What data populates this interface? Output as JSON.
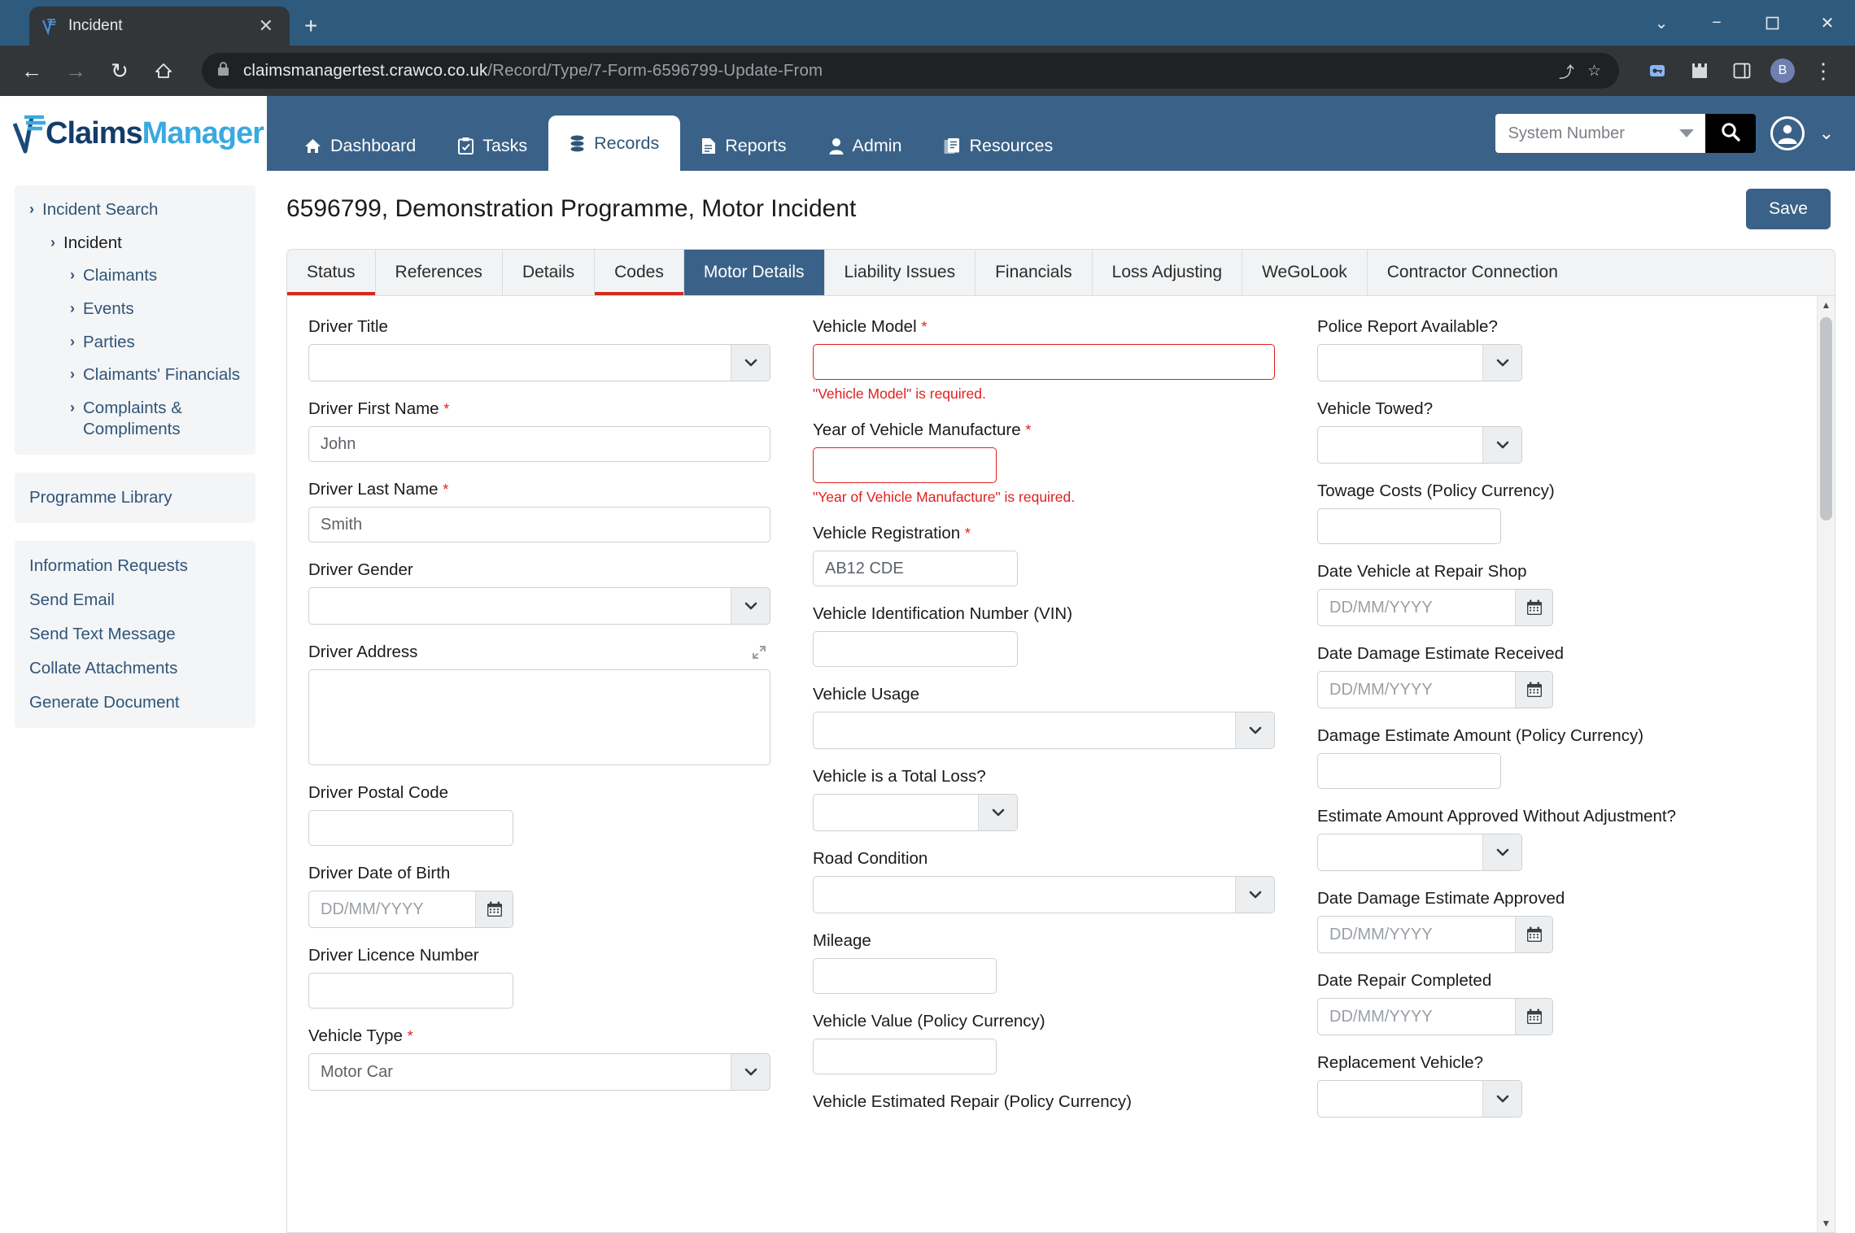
{
  "browser": {
    "tab_title": "Incident",
    "favicon": "claimsmanager-icon",
    "close_label": "✕",
    "newtab_label": "+",
    "window_minimize": "−",
    "window_restore": "❐",
    "window_close": "✕",
    "window_chevron": "⌄",
    "back": "←",
    "forward": "→",
    "reload": "↻",
    "home": "⌂",
    "lock_icon": "🔒",
    "url_domain": "claimsmanagertest.crawco.co.uk",
    "url_path": "/Record/Type/7-Form-6596799-Update-From",
    "share_icon": "⤴",
    "bookmark_icon": "☆",
    "profile_initial": "B",
    "menu_icon": "⋮"
  },
  "header": {
    "logo_part1": "Claims",
    "logo_part2": "Manager",
    "nav": [
      {
        "label": "Dashboard",
        "icon": "home-icon",
        "glyph": "🏠",
        "active": false
      },
      {
        "label": "Tasks",
        "icon": "clipboard-icon",
        "glyph": "🗒",
        "active": false
      },
      {
        "label": "Records",
        "icon": "database-icon",
        "glyph": "🗄",
        "active": true
      },
      {
        "label": "Reports",
        "icon": "document-icon",
        "glyph": "📄",
        "active": false
      },
      {
        "label": "Admin",
        "icon": "person-icon",
        "glyph": "👤",
        "active": false
      },
      {
        "label": "Resources",
        "icon": "books-icon",
        "glyph": "📑",
        "active": false
      }
    ],
    "search_placeholder": "System Number",
    "search_value": "",
    "search_button_icon": "search-icon",
    "user_icon": "user-avatar-icon",
    "user_chevron": "⌄"
  },
  "sidebar": {
    "tree": [
      {
        "label": "Incident Search",
        "level": 0,
        "chevron": "›",
        "current": false
      },
      {
        "label": "Incident",
        "level": 1,
        "chevron": "›",
        "current": true
      },
      {
        "label": "Claimants",
        "level": 2,
        "chevron": "›",
        "current": false
      },
      {
        "label": "Events",
        "level": 2,
        "chevron": "›",
        "current": false
      },
      {
        "label": "Parties",
        "level": 2,
        "chevron": "›",
        "current": false
      },
      {
        "label": "Claimants' Financials",
        "level": 2,
        "chevron": "›",
        "current": false
      },
      {
        "label": "Complaints & Compliments",
        "level": 2,
        "chevron": "›",
        "current": false
      }
    ],
    "library": [
      "Programme Library"
    ],
    "actions": [
      "Information Requests",
      "Send Email",
      "Send Text Message",
      "Collate Attachments",
      "Generate Document"
    ]
  },
  "main": {
    "page_title": "6596799, Demonstration Programme, Motor Incident",
    "save_label": "Save",
    "tabs": [
      {
        "label": "Status",
        "active": false,
        "error": true
      },
      {
        "label": "References",
        "active": false,
        "error": false
      },
      {
        "label": "Details",
        "active": false,
        "error": false
      },
      {
        "label": "Codes",
        "active": false,
        "error": true
      },
      {
        "label": "Motor Details",
        "active": true,
        "error": false
      },
      {
        "label": "Liability Issues",
        "active": false,
        "error": false
      },
      {
        "label": "Financials",
        "active": false,
        "error": false
      },
      {
        "label": "Loss Adjusting",
        "active": false,
        "error": false
      },
      {
        "label": "WeGoLook",
        "active": false,
        "error": false
      },
      {
        "label": "Contractor Connection",
        "active": false,
        "error": false
      }
    ]
  },
  "form": {
    "date_placeholder": "DD/MM/YYYY",
    "column_a": [
      {
        "label": "Driver Title",
        "type": "select",
        "value": "",
        "required": false,
        "width": "full"
      },
      {
        "label": "Driver First Name",
        "type": "text",
        "value": "John",
        "required": true,
        "width": "full"
      },
      {
        "label": "Driver Last Name",
        "type": "text",
        "value": "Smith",
        "required": true,
        "width": "full"
      },
      {
        "label": "Driver Gender",
        "type": "select",
        "value": "",
        "required": false,
        "width": "full"
      },
      {
        "label": "Driver Address",
        "type": "textarea",
        "value": "",
        "required": false,
        "width": "full",
        "expandable": true
      },
      {
        "label": "Driver Postal Code",
        "type": "text",
        "value": "",
        "required": false,
        "width": "md"
      },
      {
        "label": "Driver Date of Birth",
        "type": "date",
        "value": "",
        "required": false,
        "width": "md"
      },
      {
        "label": "Driver Licence Number",
        "type": "text",
        "value": "",
        "required": false,
        "width": "md"
      },
      {
        "label": "Vehicle Type",
        "type": "select",
        "value": "Motor Car",
        "required": true,
        "width": "full"
      }
    ],
    "column_b": [
      {
        "label": "Vehicle Model",
        "type": "text",
        "value": "",
        "required": true,
        "width": "full",
        "error": "\"Vehicle Model\" is required."
      },
      {
        "label": "Year of Vehicle Manufacture",
        "type": "text",
        "value": "",
        "required": true,
        "width": "sm",
        "error": "\"Year of Vehicle Manufacture\" is required."
      },
      {
        "label": "Vehicle Registration",
        "type": "text",
        "value": "AB12 CDE",
        "required": true,
        "width": "md"
      },
      {
        "label": "Vehicle Identification Number (VIN)",
        "type": "text",
        "value": "",
        "required": false,
        "width": "md"
      },
      {
        "label": "Vehicle Usage",
        "type": "select",
        "value": "",
        "required": false,
        "width": "full"
      },
      {
        "label": "Vehicle is a Total Loss?",
        "type": "select",
        "value": "",
        "required": false,
        "width": "md"
      },
      {
        "label": "Road Condition",
        "type": "select",
        "value": "",
        "required": false,
        "width": "full"
      },
      {
        "label": "Mileage",
        "type": "text",
        "value": "",
        "required": false,
        "width": "sm"
      },
      {
        "label": "Vehicle Value (Policy Currency)",
        "type": "text",
        "value": "",
        "required": false,
        "width": "sm"
      },
      {
        "label": "Vehicle Estimated Repair (Policy Currency)",
        "type": "label-only",
        "value": "",
        "required": false,
        "width": "sm"
      }
    ],
    "column_c": [
      {
        "label": "Police Report Available?",
        "type": "select",
        "value": "",
        "required": false,
        "width": "md"
      },
      {
        "label": "Vehicle Towed?",
        "type": "select",
        "value": "",
        "required": false,
        "width": "md"
      },
      {
        "label": "Towage Costs (Policy Currency)",
        "type": "text",
        "value": "",
        "required": false,
        "width": "sm"
      },
      {
        "label": "Date Vehicle at Repair Shop",
        "type": "date",
        "value": "",
        "required": false,
        "width": "wide"
      },
      {
        "label": "Date Damage Estimate Received",
        "type": "date",
        "value": "",
        "required": false,
        "width": "wide"
      },
      {
        "label": "Damage Estimate Amount (Policy Currency)",
        "type": "text",
        "value": "",
        "required": false,
        "width": "sm"
      },
      {
        "label": "Estimate Amount Approved Without Adjustment?",
        "type": "select",
        "value": "",
        "required": false,
        "width": "md"
      },
      {
        "label": "Date Damage Estimate Approved",
        "type": "date",
        "value": "",
        "required": false,
        "width": "wide"
      },
      {
        "label": "Date Repair Completed",
        "type": "date",
        "value": "",
        "required": false,
        "width": "wide"
      },
      {
        "label": "Replacement Vehicle?",
        "type": "select",
        "value": "",
        "required": false,
        "width": "md"
      }
    ],
    "scrollbar": {
      "up": "▲",
      "down": "▼"
    }
  },
  "colors": {
    "brand_blue": "#3a6288",
    "brand_cyan": "#3aa9e0",
    "error_red": "#e02020",
    "tab_error": "#d32a1f"
  }
}
